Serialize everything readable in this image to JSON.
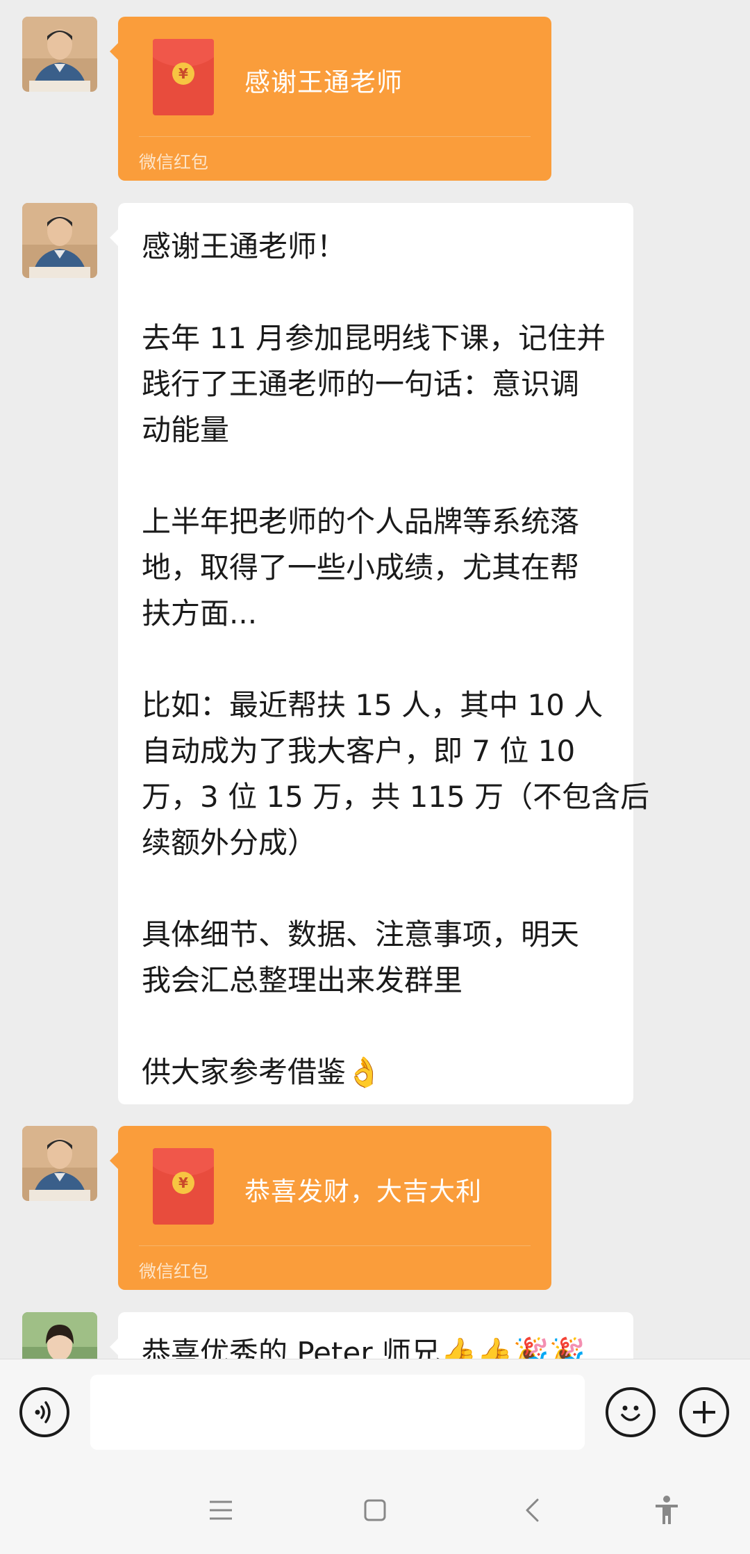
{
  "messages": [
    {
      "type": "red_packet",
      "title": "感谢王通老师",
      "label": "微信红包",
      "sender": "man"
    },
    {
      "type": "text",
      "sender": "man",
      "lines": [
        "感谢王通老师！",
        "",
        "去年 11 月参加昆明线下课，记住并",
        "践行了王通老师的一句话：意识调",
        "动能量",
        "",
        "上半年把老师的个人品牌等系统落",
        "地，取得了一些小成绩，尤其在帮",
        "扶方面...",
        "",
        "比如：最近帮扶 15 人，其中 10 人",
        "自动成为了我大客户，即 7 位 10",
        "万，3 位 15 万，共 115 万（不包含后",
        "续额外分成）",
        "",
        "具体细节、数据、注意事项，明天",
        "我会汇总整理出来发群里",
        "",
        "供大家参考借鉴👌"
      ]
    },
    {
      "type": "red_packet",
      "title": "恭喜发财，大吉大利",
      "label": "微信红包",
      "sender": "man"
    },
    {
      "type": "text",
      "sender": "woman",
      "lines": [
        "恭喜优秀的 Peter 师兄👍👍🎉🎉"
      ]
    }
  ],
  "input_bar": {
    "voice_icon": "voice-icon",
    "emoji_icon": "emoji-icon",
    "plus_icon": "plus-icon",
    "text_value": ""
  },
  "nav_bar": {
    "icons": [
      "menu-icon",
      "home-icon",
      "back-icon",
      "accessibility-icon"
    ]
  },
  "colors": {
    "red_packet": "#fa9d3b",
    "background": "#ededed",
    "bubble": "#ffffff"
  }
}
